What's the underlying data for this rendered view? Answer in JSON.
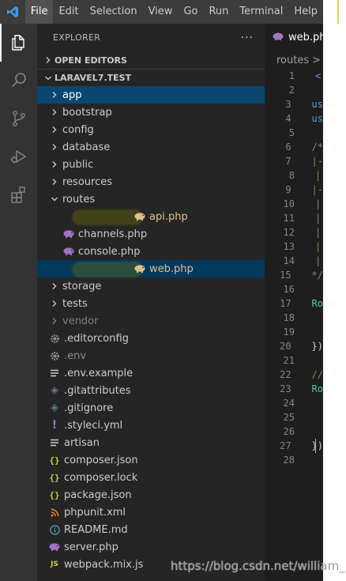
{
  "menubar": {
    "items": [
      "File",
      "Edit",
      "Selection",
      "View",
      "Go",
      "Run",
      "Terminal",
      "Help"
    ],
    "active_index": 0
  },
  "activity_bar": {
    "icons": [
      "explorer-icon",
      "search-icon",
      "source-control-icon",
      "run-debug-icon",
      "extensions-icon"
    ],
    "active": "explorer-icon"
  },
  "sidebar": {
    "title": "EXPLORER",
    "more": "···",
    "open_editors": "OPEN EDITORS",
    "project": "LARAVEL7.TEST",
    "tree": [
      {
        "label": "app",
        "type": "folder",
        "expanded": false,
        "depth": 0,
        "state": "selected"
      },
      {
        "label": "bootstrap",
        "type": "folder",
        "expanded": false,
        "depth": 0
      },
      {
        "label": "config",
        "type": "folder",
        "expanded": false,
        "depth": 0
      },
      {
        "label": "database",
        "type": "folder",
        "expanded": false,
        "depth": 0
      },
      {
        "label": "public",
        "type": "folder",
        "expanded": false,
        "depth": 0
      },
      {
        "label": "resources",
        "type": "folder",
        "expanded": false,
        "depth": 0
      },
      {
        "label": "routes",
        "type": "folder",
        "expanded": true,
        "depth": 0
      },
      {
        "label": "api.php",
        "type": "php",
        "depth": 1,
        "color": "#e2c08d",
        "state": "highlight",
        "icon_color": "#e2c08d"
      },
      {
        "label": "channels.php",
        "type": "php",
        "depth": 1,
        "icon_color": "#a074c4"
      },
      {
        "label": "console.php",
        "type": "php",
        "depth": 1,
        "icon_color": "#a074c4"
      },
      {
        "label": "web.php",
        "type": "php",
        "depth": 1,
        "color": "#e2c08d",
        "state": "active-highlight",
        "icon_color": "#e2c08d"
      },
      {
        "label": "storage",
        "type": "folder",
        "expanded": false,
        "depth": 0
      },
      {
        "label": "tests",
        "type": "folder",
        "expanded": false,
        "depth": 0
      },
      {
        "label": "vendor",
        "type": "folder",
        "expanded": false,
        "depth": 0,
        "dim": true
      },
      {
        "label": ".editorconfig",
        "type": "gear",
        "depth": 0,
        "icon_color": "#8a8a8a"
      },
      {
        "label": ".env",
        "type": "gear",
        "depth": 0,
        "dim_text": true,
        "icon_color": "#8a8a8a"
      },
      {
        "label": ".env.example",
        "type": "lines",
        "depth": 0,
        "icon_color": "#cccccc"
      },
      {
        "label": ".gitattributes",
        "type": "diamond",
        "depth": 0,
        "icon_color": "#41535b"
      },
      {
        "label": ".gitignore",
        "type": "diamond",
        "depth": 0,
        "icon_color": "#41535b"
      },
      {
        "label": ".styleci.yml",
        "type": "yml",
        "depth": 0,
        "icon_color": "#a074c4"
      },
      {
        "label": "artisan",
        "type": "lines",
        "depth": 0,
        "icon_color": "#cccccc"
      },
      {
        "label": "composer.json",
        "type": "braces",
        "depth": 0,
        "icon_color": "#cbcb41"
      },
      {
        "label": "composer.lock",
        "type": "braces",
        "depth": 0,
        "icon_color": "#cbcb41"
      },
      {
        "label": "package.json",
        "type": "braces",
        "depth": 0,
        "icon_color": "#cbcb41"
      },
      {
        "label": "phpunit.xml",
        "type": "rss",
        "depth": 0,
        "icon_color": "#e37933"
      },
      {
        "label": "README.md",
        "type": "info",
        "depth": 0,
        "icon_color": "#519aba"
      },
      {
        "label": "server.php",
        "type": "php",
        "depth": 0,
        "icon_color": "#a074c4"
      },
      {
        "label": "webpack.mix.js",
        "type": "js",
        "depth": 0,
        "icon_color": "#cbcb41"
      }
    ]
  },
  "editor": {
    "tab_label": "web.php",
    "breadcrumb": [
      "routes",
      ">"
    ],
    "lines": [
      {
        "n": "1",
        "text": "<",
        "color": "#569cd6"
      },
      {
        "n": "2",
        "text": "",
        "color": "#d4d4d4"
      },
      {
        "n": "3",
        "text": "us",
        "color": "#569cd6"
      },
      {
        "n": "4",
        "text": "us",
        "color": "#569cd6"
      },
      {
        "n": "5",
        "text": "",
        "color": "#d4d4d4"
      },
      {
        "n": "6",
        "text": "/*",
        "color": "#6a9955"
      },
      {
        "n": "7",
        "text": "|-",
        "color": "#6a9955"
      },
      {
        "n": "8",
        "text": "|",
        "color": "#6a9955"
      },
      {
        "n": "9",
        "text": "|-",
        "color": "#6a9955"
      },
      {
        "n": "10",
        "text": "|",
        "color": "#6a9955"
      },
      {
        "n": "11",
        "text": "|",
        "color": "#6a9955"
      },
      {
        "n": "12",
        "text": "|",
        "color": "#6a9955"
      },
      {
        "n": "13",
        "text": "|",
        "color": "#6a9955"
      },
      {
        "n": "14",
        "text": "|",
        "color": "#6a9955"
      },
      {
        "n": "15",
        "text": "*/",
        "color": "#6a9955"
      },
      {
        "n": "16",
        "text": "",
        "color": "#d4d4d4"
      },
      {
        "n": "17",
        "text": "Ro",
        "color": "#4ec9b0"
      },
      {
        "n": "18",
        "text": "",
        "color": "#d4d4d4"
      },
      {
        "n": "19",
        "text": "",
        "color": "#d4d4d4"
      },
      {
        "n": "20",
        "text": "})",
        "color": "#d4d4d4"
      },
      {
        "n": "21",
        "text": "",
        "color": "#d4d4d4"
      },
      {
        "n": "22",
        "text": "//",
        "color": "#6a9955"
      },
      {
        "n": "23",
        "text": "Ro",
        "color": "#4ec9b0"
      },
      {
        "n": "24",
        "text": "",
        "color": "#d4d4d4"
      },
      {
        "n": "25",
        "text": "",
        "color": "#d4d4d4"
      },
      {
        "n": "26",
        "text": "",
        "color": "#d4d4d4"
      },
      {
        "n": "27",
        "text": "})",
        "color": "#d4d4d4"
      },
      {
        "n": "28",
        "text": "",
        "color": "#d4d4d4"
      }
    ],
    "cursor_line": "27"
  },
  "watermark": "https://blog.csdn.net/william_n"
}
